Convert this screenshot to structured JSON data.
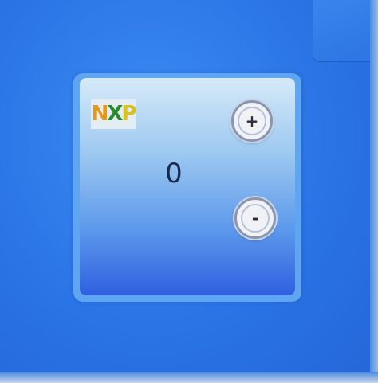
{
  "logo": {
    "letters": [
      "N",
      "X",
      "P"
    ],
    "colors": [
      "#e39a1c",
      "#2b8a2b",
      "#d8c21f"
    ]
  },
  "counter": {
    "value": "0"
  },
  "buttons": {
    "increment_label": "+",
    "decrement_label": "-"
  },
  "theme": {
    "background": "#2a78e8",
    "panel": "#5fa6f2"
  }
}
